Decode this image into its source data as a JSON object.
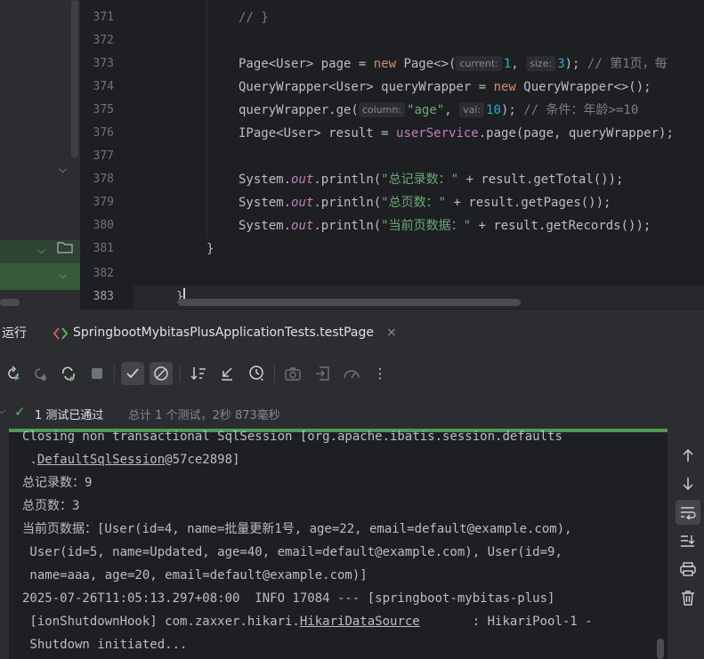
{
  "editor": {
    "lines": [
      {
        "number": "371",
        "text": "// }"
      },
      {
        "number": "372",
        "text": ""
      },
      {
        "number": "373",
        "code_a": "Page<User> page = ",
        "kw_new": "new",
        "code_b": " Page<>(",
        "hint_current": "current:",
        "val_current": "1",
        "code_c": ", ",
        "hint_size": "size:",
        "val_size": "3",
        "code_d": "); ",
        "comment": "// 第1页，每"
      },
      {
        "number": "374",
        "code_a": "QueryWrapper<User> queryWrapper = ",
        "kw_new": "new",
        "code_b": " QueryWrapper<>();"
      },
      {
        "number": "375",
        "code_a": "queryWrapper.ge(",
        "hint_column": "column:",
        "val_column": "\"age\"",
        "code_b": ", ",
        "hint_val": "val:",
        "val_val": "10",
        "code_c": "); ",
        "comment": "// 条件：年龄>=10"
      },
      {
        "number": "376",
        "code_a": "IPage<User> result = ",
        "service": "userService",
        "code_b": ".page(page, queryWrapper);"
      },
      {
        "number": "377",
        "text": ""
      },
      {
        "number": "378",
        "code_a": "System.",
        "field": "out",
        "code_b": ".println(",
        "str": "\"总记录数：\"",
        "code_c": " + result.getTotal());"
      },
      {
        "number": "379",
        "code_a": "System.",
        "field": "out",
        "code_b": ".println(",
        "str": "\"总页数：\"",
        "code_c": " + result.getPages());"
      },
      {
        "number": "380",
        "code_a": "System.",
        "field": "out",
        "code_b": ".println(",
        "str": "\"当前页数据：\"",
        "code_c": " + result.getRecords());"
      },
      {
        "number": "381",
        "text": "}"
      },
      {
        "number": "382",
        "text": ""
      },
      {
        "number": "383",
        "text": "}"
      }
    ]
  },
  "run": {
    "title": "运行",
    "tab_label": "SpringbootMybitasPlusApplicationTests.testPage",
    "tab_close": "×",
    "status_passed": "1 测试已通过",
    "status_summary": "总计 1 个测试，2秒 873毫秒",
    "console": {
      "line1": "Closing non transactional SqlSession [org.apache.ibatis.session.defaults",
      "line2_prefix": " .",
      "line2_link": "DefaultSqlSession",
      "line2_suffix": "@57ce2898]",
      "line3": "总记录数：9",
      "line4": "总页数：3",
      "line5": "当前页数据：[User(id=4, name=批量更新1号, age=22, email=default@example.com),",
      "line6": " User(id=5, name=Updated, age=40, email=default@example.com), User(id=9,",
      "line7": " name=aaa, age=20, email=default@example.com)]",
      "line8": "2025-07-26T11:05:13.297+08:00  INFO 17084 --- [springboot-mybitas-plus]",
      "line9_prefix": " [ionShutdownHook] com.zaxxer.hikari.",
      "line9_link": "HikariDataSource",
      "line9_suffix": "       : HikariPool-1 -",
      "line10": " Shutdown initiated..."
    }
  },
  "icons": {
    "rerun": "rerun-icon",
    "rerun_failed": "rerun-failed-icon",
    "toggle_auto_test": "auto-test-icon",
    "stop": "stop-icon",
    "show_passed": "check-icon",
    "show_ignored": "ignored-icon",
    "sort": "sort-icon",
    "collapse": "collapse-icon",
    "history": "history-icon",
    "camera": "camera-icon",
    "import": "import-icon",
    "coverage": "coverage-icon",
    "more": "more-icon"
  },
  "colors": {
    "pass_green": "#5fb865",
    "progress_green": "#4e9a54",
    "keyword": "#cf8e6d",
    "string": "#6aab73",
    "number": "#2aacb8"
  }
}
